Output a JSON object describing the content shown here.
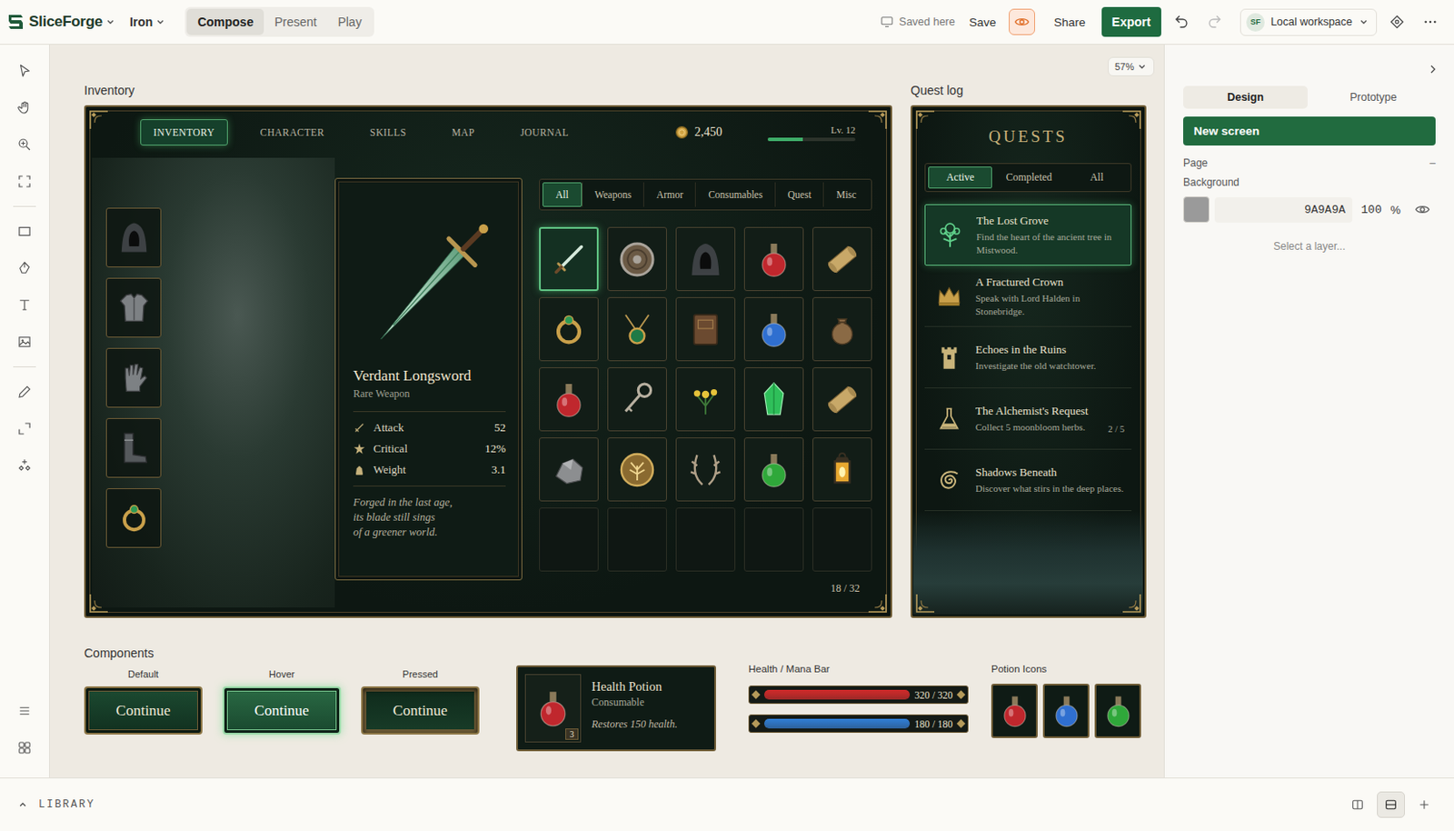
{
  "topbar": {
    "logo": "SliceForge",
    "theme": "Iron",
    "modes": [
      {
        "label": "Compose",
        "selected": true
      },
      {
        "label": "Present",
        "selected": false
      },
      {
        "label": "Play",
        "selected": false
      }
    ],
    "saved": "Saved here",
    "save": "Save",
    "preview_on": true,
    "share": "Share",
    "export": "Export",
    "undo_disabled": false,
    "redo_disabled": true,
    "workspace": {
      "avatar": "SF",
      "name": "Local workspace"
    }
  },
  "canvas": {
    "zoom": "57%"
  },
  "inventory": {
    "label": "Inventory",
    "nav": [
      {
        "label": "INVENTORY",
        "selected": true
      },
      {
        "label": "CHARACTER",
        "selected": false
      },
      {
        "label": "SKILLS",
        "selected": false
      },
      {
        "label": "MAP",
        "selected": false
      },
      {
        "label": "JOURNAL",
        "selected": false
      }
    ],
    "gold": "2,450",
    "level": "Lv. 12",
    "xp": 0.4,
    "equipment": [
      {
        "kind": "hood"
      },
      {
        "kind": "armor"
      },
      {
        "kind": "gloves"
      },
      {
        "kind": "boots"
      },
      {
        "kind": "ring"
      }
    ],
    "item": {
      "name": "Verdant Longsword",
      "rarity": "Rare Weapon",
      "stats": [
        {
          "kind": "attack",
          "label": "Attack",
          "value": "52"
        },
        {
          "kind": "critical",
          "label": "Critical",
          "value": "12%"
        },
        {
          "kind": "weight",
          "label": "Weight",
          "value": "3.1"
        }
      ],
      "lore": [
        "Forged in the last age,",
        "its blade still sings",
        "of a greener world."
      ]
    },
    "filters": [
      {
        "label": "All",
        "selected": true
      },
      {
        "label": "Weapons",
        "selected": false
      },
      {
        "label": "Armor",
        "selected": false
      },
      {
        "label": "Consumables",
        "selected": false
      },
      {
        "label": "Quest",
        "selected": false
      },
      {
        "label": "Misc",
        "selected": false
      }
    ],
    "slots": [
      {
        "kind": "sword",
        "selected": true
      },
      {
        "kind": "shield",
        "selected": false
      },
      {
        "kind": "hood",
        "selected": false
      },
      {
        "kind": "potion",
        "color": "#c0272d",
        "selected": false
      },
      {
        "kind": "scroll",
        "selected": false
      },
      {
        "kind": "ring",
        "selected": false
      },
      {
        "kind": "amulet",
        "selected": false
      },
      {
        "kind": "book",
        "selected": false
      },
      {
        "kind": "potion",
        "color": "#2f6fd0",
        "selected": false
      },
      {
        "kind": "pouch",
        "selected": false
      },
      {
        "kind": "potion",
        "color": "#c0272d",
        "selected": false
      },
      {
        "kind": "key",
        "selected": false
      },
      {
        "kind": "flowers",
        "selected": false
      },
      {
        "kind": "gem",
        "selected": false
      },
      {
        "kind": "scroll",
        "selected": false
      },
      {
        "kind": "ore",
        "selected": false
      },
      {
        "kind": "emblem",
        "selected": false
      },
      {
        "kind": "antlers",
        "selected": false
      },
      {
        "kind": "potion",
        "color": "#2fa83a",
        "selected": false
      },
      {
        "kind": "lantern",
        "selected": false
      },
      {
        "kind": "empty",
        "selected": false
      },
      {
        "kind": "empty",
        "selected": false
      },
      {
        "kind": "empty",
        "selected": false
      },
      {
        "kind": "empty",
        "selected": false
      },
      {
        "kind": "empty",
        "selected": false
      }
    ],
    "count": "18 / 32"
  },
  "quest_log": {
    "label": "Quest log",
    "title": "QUESTS",
    "tabs": [
      {
        "label": "Active",
        "selected": true
      },
      {
        "label": "Completed",
        "selected": false
      },
      {
        "label": "All",
        "selected": false
      }
    ],
    "quests": [
      {
        "kind": "tree",
        "title": "The Lost Grove",
        "desc": "Find the heart of the ancient tree in Mistwood.",
        "selected": true
      },
      {
        "kind": "crown",
        "title": "A Fractured Crown",
        "desc": "Speak with Lord Halden in Stonebridge.",
        "selected": false
      },
      {
        "kind": "tower",
        "title": "Echoes in the Ruins",
        "desc": "Investigate the old watchtower.",
        "selected": false
      },
      {
        "kind": "flask",
        "title": "The Alchemist's Request",
        "desc": "Collect 5 moonbloom herbs.",
        "progress": "2 / 5",
        "selected": false
      },
      {
        "kind": "spiral",
        "title": "Shadows Beneath",
        "desc": "Discover what stirs in the deep places.",
        "selected": false
      }
    ]
  },
  "components": {
    "label": "Components",
    "buttons": [
      {
        "state": "Default",
        "label": "Continue",
        "kind": "default"
      },
      {
        "state": "Hover",
        "label": "Continue",
        "kind": "hover"
      },
      {
        "state": "Pressed",
        "label": "Continue",
        "kind": "pressed"
      }
    ],
    "item_card": {
      "name": "Health Potion",
      "type": "Consumable",
      "effect": "Restores 150 health.",
      "count": "3",
      "color": "#c0272d"
    },
    "bars": {
      "label": "Health / Mana Bar",
      "items": [
        {
          "reading": "320 / 320",
          "level": 1,
          "color": "#d42a2a"
        },
        {
          "reading": "180 / 180",
          "level": 1,
          "color": "#2f7fd8"
        }
      ]
    },
    "potions": {
      "label": "Potion Icons",
      "items": [
        {
          "color": "#c0272d"
        },
        {
          "color": "#2f6fd0"
        },
        {
          "color": "#2fa83a"
        }
      ]
    }
  },
  "panel": {
    "tabs": [
      {
        "label": "Design",
        "selected": true
      },
      {
        "label": "Prototype",
        "selected": false
      }
    ],
    "new_screen": "New screen",
    "page": {
      "label": "Page",
      "collapse": "–"
    },
    "background": {
      "label": "Background",
      "color": "#9A9A9A",
      "hex": "9A9A9A",
      "opacity": "100",
      "unit": "%",
      "visible": true
    },
    "empty": "Select a layer..."
  },
  "library": {
    "label": "LIBRARY",
    "expanded": false,
    "views": [
      {
        "kind": "split",
        "selected": false
      },
      {
        "kind": "single",
        "selected": true
      }
    ]
  }
}
